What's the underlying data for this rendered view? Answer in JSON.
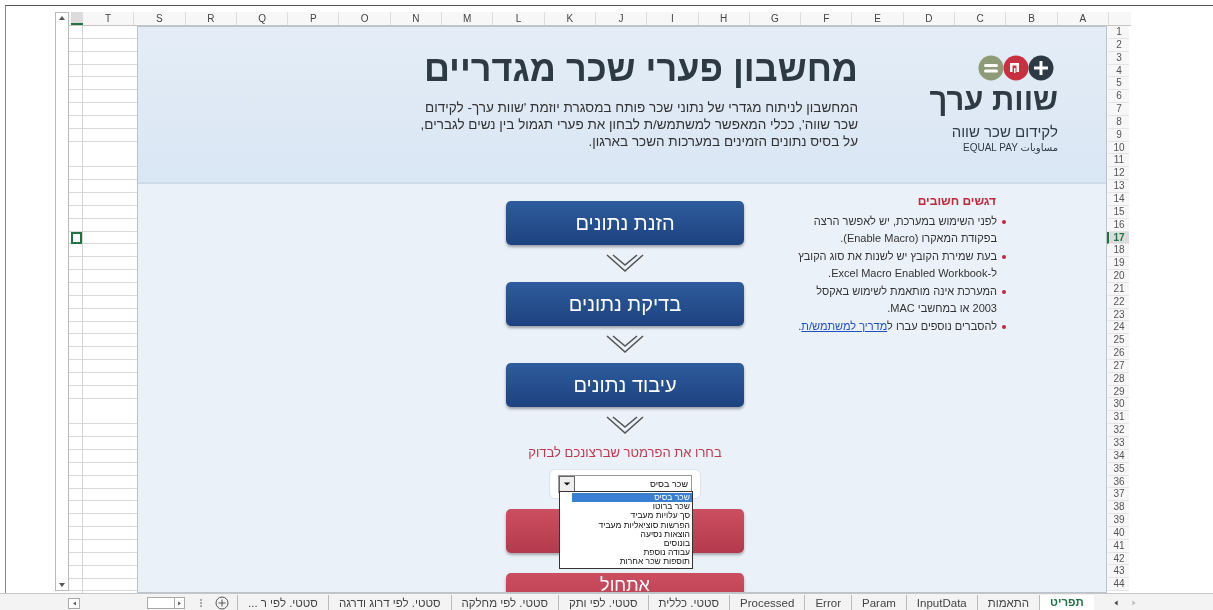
{
  "column_headers": [
    "A",
    "B",
    "C",
    "D",
    "E",
    "F",
    "G",
    "H",
    "I",
    "J",
    "K",
    "L",
    "M",
    "N",
    "O",
    "P",
    "Q",
    "R",
    "S",
    "T"
  ],
  "row_headers": [
    {
      "label": "1",
      "selected": false
    },
    {
      "label": "2",
      "selected": false
    },
    {
      "label": "3",
      "selected": false
    },
    {
      "label": "4",
      "selected": false
    },
    {
      "label": "5",
      "selected": false
    },
    {
      "label": "6",
      "selected": false
    },
    {
      "label": "7",
      "selected": false
    },
    {
      "label": "8",
      "selected": false
    },
    {
      "label": "9",
      "selected": false
    },
    {
      "label": "10",
      "selected": false
    },
    {
      "label": "11",
      "selected": false
    },
    {
      "label": "12",
      "selected": false
    },
    {
      "label": "13",
      "selected": false
    },
    {
      "label": "14",
      "selected": false
    },
    {
      "label": "15",
      "selected": false
    },
    {
      "label": "16",
      "selected": false
    },
    {
      "label": "17",
      "selected": true
    },
    {
      "label": "18",
      "selected": false
    },
    {
      "label": "19",
      "selected": false
    },
    {
      "label": "20",
      "selected": false
    },
    {
      "label": "21",
      "selected": false
    },
    {
      "label": "22",
      "selected": false
    },
    {
      "label": "23",
      "selected": false
    },
    {
      "label": "24",
      "selected": false
    },
    {
      "label": "25",
      "selected": false
    },
    {
      "label": "26",
      "selected": false
    },
    {
      "label": "27",
      "selected": false
    },
    {
      "label": "28",
      "selected": false
    },
    {
      "label": "29",
      "selected": false
    },
    {
      "label": "30",
      "selected": false
    },
    {
      "label": "31",
      "selected": false
    },
    {
      "label": "32",
      "selected": false
    },
    {
      "label": "33",
      "selected": false
    },
    {
      "label": "34",
      "selected": false
    },
    {
      "label": "35",
      "selected": false
    },
    {
      "label": "36",
      "selected": false
    },
    {
      "label": "37",
      "selected": false
    },
    {
      "label": "38",
      "selected": false
    },
    {
      "label": "39",
      "selected": false
    },
    {
      "label": "40",
      "selected": false
    },
    {
      "label": "41",
      "selected": false
    },
    {
      "label": "42",
      "selected": false
    },
    {
      "label": "43",
      "selected": false
    },
    {
      "label": "44",
      "selected": false
    }
  ],
  "header": {
    "logo": {
      "name": "שוות ערך",
      "tagline": "לקידום שכר שווה",
      "subtitle": "مساويات EQUAL PAY"
    },
    "title": "מחשבון פערי שכר מגדריים",
    "description": [
      "המחשבון לניתוח מגדרי של נתוני שכר פותח במסגרת יוזמת 'שוות ערך- לקידום",
      "שכר שווה', ככלי המאפשר למשתמש/ת לבחון את פערי תגמול בין נשים לגברים,",
      "על בסיס נתונים הזמינים במערכות השכר בארגון."
    ]
  },
  "notes": {
    "heading": "דגשים חשובים",
    "items": [
      {
        "kind": "text",
        "text": "לפני השימוש במערכת, יש לאפשר הרצה בפקודת המאקרו (Enable Macro)."
      },
      {
        "kind": "text",
        "text": "בעת שמירת הקובץ יש לשנות את סוג הקובץ ל-Excel Macro Enabled Workbook."
      },
      {
        "kind": "text",
        "text": "המערכת אינה מותאמת לשימוש באקסל 2003 או במחשבי MAC."
      },
      {
        "kind": "link",
        "text": "להסברים נוספים עברו ל",
        "link": "מדריך למשתמש/ת",
        "suffix": "."
      }
    ]
  },
  "steps": [
    "הזנת נתונים",
    "בדיקת נתונים",
    "עיבוד נתונים"
  ],
  "parameter_prompt": "בחרו את הפרמטר שברצונכם לבדוק",
  "parameter_select": {
    "value": "שכר בסיס",
    "expanded": true,
    "options": [
      {
        "label": "שכר בסיס",
        "selected": true
      },
      {
        "label": "שכר ברוטו",
        "selected": false
      },
      {
        "label": "סך עלויות מעביד",
        "selected": false
      },
      {
        "label": "הפרשות סוציאליות מעביד",
        "selected": false
      },
      {
        "label": "הוצאות נסיעה",
        "selected": false
      },
      {
        "label": "בונוסים",
        "selected": false
      },
      {
        "label": "עבודה נוספת",
        "selected": false
      },
      {
        "label": "תוספות שכר אחרות",
        "selected": false
      }
    ]
  },
  "action_buttons": [
    {
      "kind": "covered"
    },
    {
      "kind": "labeled",
      "label": "אתחול"
    }
  ],
  "sheet_tabs": [
    {
      "label": "תפריט",
      "selected": true
    },
    {
      "label": "התאמות",
      "selected": false
    },
    {
      "label": "InputData",
      "selected": false
    },
    {
      "label": "Param",
      "selected": false
    },
    {
      "label": "Error",
      "selected": false
    },
    {
      "label": "Processed",
      "selected": false
    },
    {
      "label": "סטטי. כללית",
      "selected": false
    },
    {
      "label": "סטטי. לפי ותק",
      "selected": false
    },
    {
      "label": "סטטי. לפי מחלקה",
      "selected": false
    },
    {
      "label": "סטטי. לפי דרוג ודרגה",
      "selected": false
    },
    {
      "label": "סטטי. לפי ר ...",
      "selected": false
    }
  ]
}
